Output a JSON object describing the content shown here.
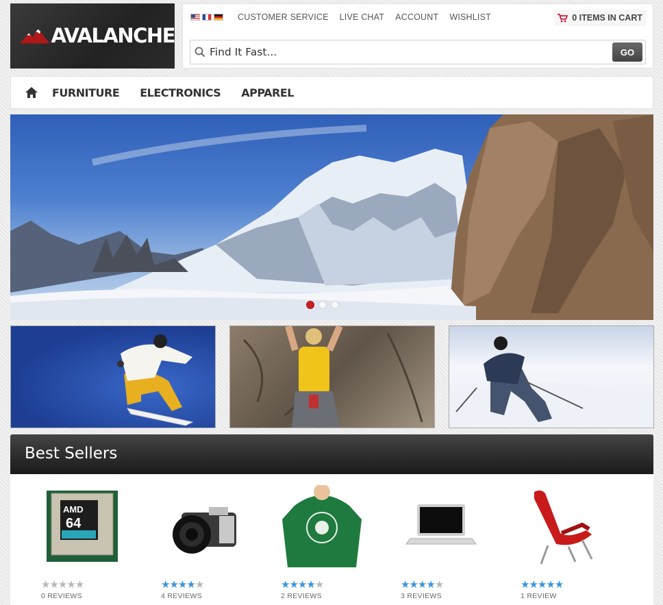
{
  "brand": {
    "name": "AVALANCHE"
  },
  "topbar": {
    "flags": [
      "us-flag-icon",
      "fr-flag-icon",
      "de-flag-icon"
    ],
    "links": [
      "CUSTOMER SERVICE",
      "LIVE CHAT",
      "ACCOUNT",
      "WISHLIST"
    ],
    "cart_label": "0 ITEMS IN CART"
  },
  "search": {
    "placeholder": "Find It Fast...",
    "button": "GO"
  },
  "nav": {
    "items": [
      "FURNITURE",
      "ELECTRONICS",
      "APPAREL"
    ]
  },
  "hero": {
    "slides": 3,
    "active_slide": 1
  },
  "tiles": [
    "snowboarder-image",
    "climber-image",
    "skier-image"
  ],
  "best_sellers": {
    "title": "Best Sellers",
    "products": [
      {
        "image": "amd-athlon-cpu-image",
        "rating": 0,
        "reviews": "0 REVIEWS"
      },
      {
        "image": "camera-image",
        "rating": 4,
        "reviews": "4 REVIEWS"
      },
      {
        "image": "green-hoodie-image",
        "rating": 4,
        "reviews": "2 REVIEWS"
      },
      {
        "image": "laptop-image",
        "rating": 4,
        "reviews": "3 REVIEWS"
      },
      {
        "image": "red-chair-image",
        "rating": 5,
        "reviews": "1 REVIEW"
      }
    ]
  },
  "colors": {
    "accent": "#c91f1f",
    "star": "#3a95df",
    "header_dark": "#222222"
  }
}
